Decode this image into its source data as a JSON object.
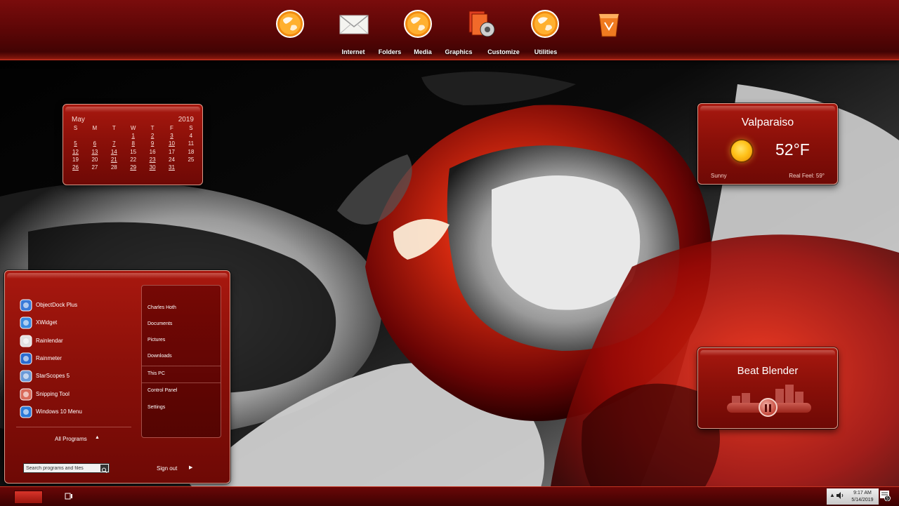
{
  "dock": {
    "items": [
      {
        "label": "Internet",
        "icon": "globe-icon"
      },
      {
        "label": "Folders",
        "icon": "envelope-icon"
      },
      {
        "label": "Media",
        "icon": "globe-icon"
      },
      {
        "label": "Graphics",
        "icon": "graphics-icon"
      },
      {
        "label": "Customize",
        "icon": "globe-icon"
      },
      {
        "label": "Utilities",
        "icon": "recycle-bin-icon"
      }
    ]
  },
  "calendar": {
    "month": "May",
    "year": "2019",
    "weekdays": [
      "S",
      "M",
      "T",
      "W",
      "T",
      "F",
      "S"
    ],
    "weeks": [
      [
        "",
        "",
        "",
        "1",
        "2",
        "3",
        "4"
      ],
      [
        "5",
        "6",
        "7",
        "8",
        "9",
        "10",
        "11"
      ],
      [
        "12",
        "13",
        "14",
        "15",
        "16",
        "17",
        "18"
      ],
      [
        "19",
        "20",
        "21",
        "22",
        "23",
        "24",
        "25"
      ],
      [
        "26",
        "27",
        "28",
        "29",
        "30",
        "31",
        ""
      ]
    ],
    "underlined": [
      "1",
      "2",
      "3",
      "5",
      "6",
      "7",
      "8",
      "9",
      "10",
      "12",
      "13",
      "14",
      "21",
      "23",
      "26",
      "29",
      "30",
      "31"
    ]
  },
  "weather": {
    "city": "Valparaiso",
    "temperature": "52°F",
    "condition": "Sunny",
    "real_feel": "Real Feel: 59°",
    "icon": "sun-icon"
  },
  "beat_blender": {
    "title": "Beat Blender",
    "state": "paused"
  },
  "start_menu": {
    "programs": [
      {
        "label": "ObjectDock Plus",
        "icon": "objectdock-icon"
      },
      {
        "label": "XWidget",
        "icon": "xwidget-icon"
      },
      {
        "label": "Rainlendar",
        "icon": "rainlendar-icon"
      },
      {
        "label": "Rainmeter",
        "icon": "rainmeter-icon"
      },
      {
        "label": "StarScopes 5",
        "icon": "starscopes-icon"
      },
      {
        "label": "Snipping Tool",
        "icon": "snipping-tool-icon"
      },
      {
        "label": "Windows 10 Menu",
        "icon": "windows-menu-icon"
      }
    ],
    "all_programs": "All Programs",
    "right_items": [
      {
        "label": "Charles Hoth"
      },
      {
        "label": "Documents"
      },
      {
        "label": "Pictures"
      },
      {
        "label": "Downloads"
      },
      {
        "label": "This PC"
      },
      {
        "label": "Control Panel"
      },
      {
        "label": "Settings"
      }
    ],
    "search_placeholder": "Search programs and files",
    "sign_out": "Sign out"
  },
  "taskbar": {
    "time": "9:17 AM",
    "date": "5/14/2019",
    "notification_count": "5"
  },
  "colors": {
    "accent": "#8b1009",
    "panel_border": "#d99a8a",
    "taskbar": "#4e0404"
  }
}
